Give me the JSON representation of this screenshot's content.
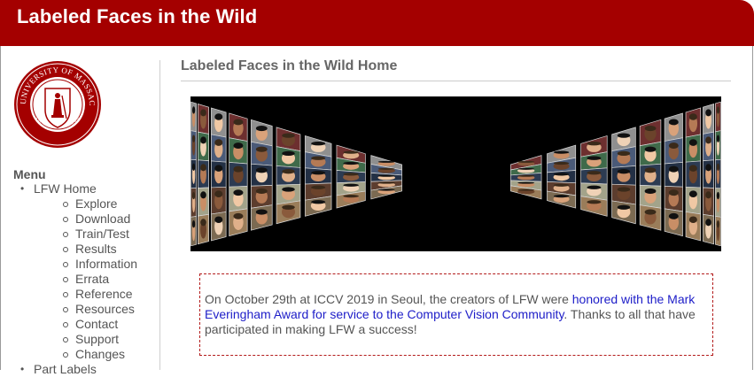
{
  "header": {
    "title": "Labeled Faces in the Wild"
  },
  "logo": {
    "ring_text": "UNIVERSITY OF MASSACHUSETTS",
    "base_text": "AMHERST 1863",
    "color": "#a40000"
  },
  "sidebar": {
    "menu_heading": "Menu",
    "items": [
      {
        "label": "LFW Home",
        "children": [
          "Explore",
          "Download",
          "Train/Test",
          "Results",
          "Information",
          "Errata",
          "Reference",
          "Resources",
          "Contact",
          "Support",
          "Changes"
        ]
      },
      {
        "label": "Part Labels",
        "children": []
      }
    ]
  },
  "main": {
    "page_title": "Labeled Faces in the Wild Home",
    "notice": {
      "text_before": "On October 29th at ICCV 2019 in Seoul, the creators of LFW were ",
      "link_text": "honored with the Mark Everingham Award for service to the Computer Vision Community",
      "text_after": ". Thanks to all that have participated in making LFW a success!"
    }
  },
  "colors": {
    "brand": "#a40000",
    "link": "#1d1dc8",
    "text": "#555555"
  }
}
